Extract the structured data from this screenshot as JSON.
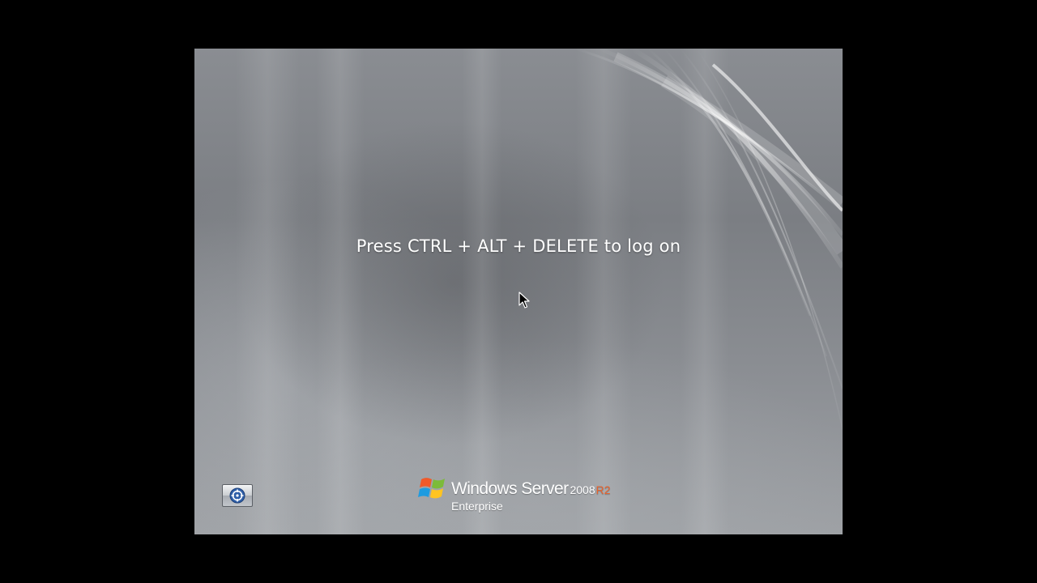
{
  "logon": {
    "prompt": "Press CTRL + ALT + DELETE to log on"
  },
  "branding": {
    "product": "Windows Server",
    "version": "2008",
    "release": "R2",
    "edition": "Enterprise",
    "release_color": "#e8622c"
  },
  "ease_of_access": {
    "icon": "ease-of-access-icon"
  },
  "colors": {
    "outer_background": "#000000",
    "screen_background": "#84878c",
    "text": "#ffffff"
  }
}
